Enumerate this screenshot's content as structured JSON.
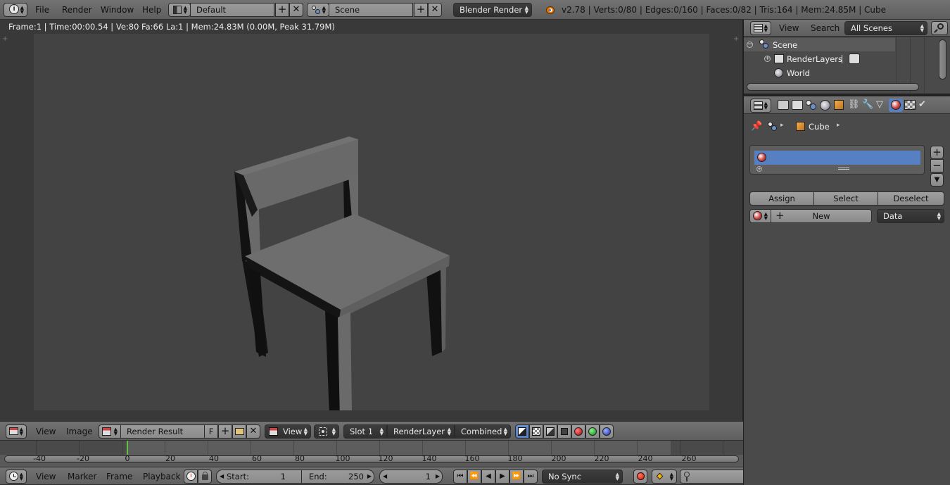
{
  "top_header": {
    "menus": [
      "File",
      "Render",
      "Window",
      "Help"
    ],
    "layout_name": "Default",
    "scene_name": "Scene",
    "render_engine": "Blender Render",
    "stats": "v2.78 | Verts:0/80 | Edges:0/160 | Faces:0/82 | Tris:164 | Mem:24.85M | Cube"
  },
  "viewport": {
    "overlay_info": "Frame:1 | Time:00:00.54 | Ve:80 Fa:66 La:1 | Mem:24.83M (0.00M, Peak 31.79M)",
    "content": "chair-render"
  },
  "image_editor_header": {
    "menus": [
      "View",
      "Image"
    ],
    "image_name": "Render Result",
    "fake_user": "F",
    "view_label": "View",
    "slot": "Slot 1",
    "layer": "RenderLayer",
    "pass": "Combined"
  },
  "timeline": {
    "ticks": [
      "-40",
      "-20",
      "0",
      "20",
      "40",
      "60",
      "80",
      "100",
      "120",
      "140",
      "160",
      "180",
      "200",
      "220",
      "240",
      "260"
    ],
    "menus": [
      "View",
      "Marker",
      "Frame",
      "Playback"
    ],
    "start_label": "Start:",
    "start_value": "1",
    "end_label": "End:",
    "end_value": "250",
    "current_frame": "1",
    "sync": "No Sync"
  },
  "outliner": {
    "menus": [
      "View",
      "Search"
    ],
    "filter": "All Scenes",
    "items": [
      {
        "label": "Scene",
        "icon": "scene-icon"
      },
      {
        "label": "RenderLayers",
        "icon": "render-layers-icon"
      },
      {
        "label": "World",
        "icon": "world-icon"
      }
    ]
  },
  "properties": {
    "breadcrumb_object": "Cube",
    "buttons": {
      "assign": "Assign",
      "select": "Select",
      "deselect": "Deselect",
      "new": "New",
      "link": "Data"
    },
    "colors": {
      "selected_slot": "#5680c2",
      "active_tab": "#5680c2"
    }
  }
}
